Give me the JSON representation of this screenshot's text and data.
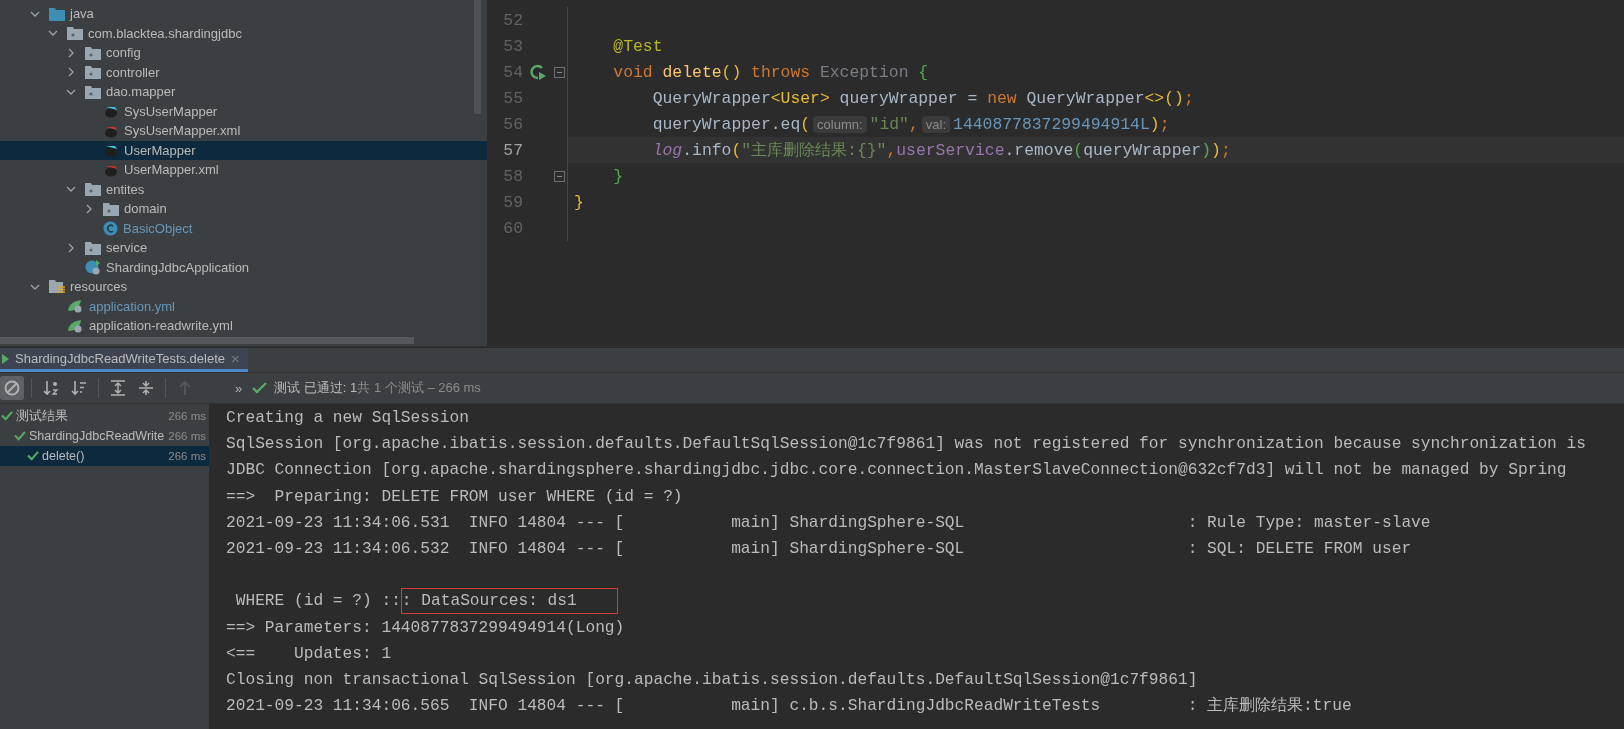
{
  "project_tree": {
    "items": [
      {
        "label": "java",
        "kind": "source-folder",
        "expanded": true,
        "selected": false,
        "modified": false,
        "children": [
          {
            "label": "com.blacktea.shardingjdbc",
            "kind": "package",
            "expanded": true,
            "selected": false,
            "modified": false,
            "children": [
              {
                "label": "config",
                "kind": "package",
                "expanded": false,
                "selected": false,
                "modified": false
              },
              {
                "label": "controller",
                "kind": "package",
                "expanded": false,
                "selected": false,
                "modified": false
              },
              {
                "label": "dao.mapper",
                "kind": "package",
                "expanded": true,
                "selected": false,
                "modified": false,
                "children": [
                  {
                    "label": "SysUserMapper",
                    "kind": "mapper",
                    "selected": false,
                    "modified": false
                  },
                  {
                    "label": "SysUserMapper.xml",
                    "kind": "mapper-xml",
                    "selected": false,
                    "modified": false
                  },
                  {
                    "label": "UserMapper",
                    "kind": "mapper",
                    "selected": true,
                    "modified": false
                  },
                  {
                    "label": "UserMapper.xml",
                    "kind": "mapper-xml",
                    "selected": false,
                    "modified": false
                  }
                ]
              },
              {
                "label": "entites",
                "kind": "package",
                "expanded": true,
                "selected": false,
                "modified": false,
                "children": [
                  {
                    "label": "domain",
                    "kind": "package",
                    "expanded": false,
                    "selected": false,
                    "modified": false
                  },
                  {
                    "label": "BasicObject",
                    "kind": "class",
                    "selected": false,
                    "modified": true
                  }
                ]
              },
              {
                "label": "service",
                "kind": "package",
                "expanded": false,
                "selected": false,
                "modified": false
              },
              {
                "label": "ShardingJdbcApplication",
                "kind": "spring-class",
                "selected": false,
                "modified": false
              }
            ]
          }
        ]
      },
      {
        "label": "resources",
        "kind": "resource-folder",
        "expanded": true,
        "selected": false,
        "modified": false,
        "children": [
          {
            "label": "application.yml",
            "kind": "yml",
            "selected": false,
            "modified": true
          },
          {
            "label": "application-readwrite.yml",
            "kind": "yml",
            "selected": false,
            "modified": false
          }
        ]
      }
    ]
  },
  "editor": {
    "lines": [
      {
        "number": "52",
        "current": false,
        "run_marker": false,
        "fold": false
      },
      {
        "number": "53",
        "kind": "member",
        "current": false,
        "run_marker": false,
        "fold": false,
        "tokens": [
          {
            "kind": "annotation",
            "text": "@Test"
          }
        ]
      },
      {
        "number": "54",
        "kind": "member",
        "current": false,
        "run_marker": true,
        "fold": true,
        "tokens": [
          {
            "kind": "keyword",
            "text": "void"
          },
          {
            "kind": "method",
            "text": "delete",
            "gap": true
          },
          {
            "kind": "paren1",
            "text": "()"
          },
          {
            "kind": "keyword",
            "text": "throws",
            "gap": true
          },
          {
            "kind": "unused",
            "text": "Exception",
            "gap": true
          },
          {
            "kind": "paren2",
            "text": "{",
            "gap": true
          }
        ]
      },
      {
        "number": "55",
        "kind": "statement",
        "current": false,
        "run_marker": false,
        "fold": false,
        "tokens": [
          {
            "kind": "plain",
            "text": "QueryWrapper"
          },
          {
            "kind": "paren1",
            "text": "<User>"
          },
          {
            "kind": "plain",
            "text": "queryWrapper =",
            "gap": true
          },
          {
            "kind": "keyword",
            "text": "new",
            "gap": true
          },
          {
            "kind": "plain",
            "text": "QueryWrapper",
            "gap": true
          },
          {
            "kind": "paren1",
            "text": "<>()"
          },
          {
            "kind": "keyword",
            "text": ";"
          }
        ]
      },
      {
        "number": "56",
        "kind": "statement",
        "current": false,
        "run_marker": false,
        "fold": false,
        "tokens": [
          {
            "kind": "plain",
            "text": "queryWrapper.eq"
          },
          {
            "kind": "paren1",
            "text": "("
          },
          {
            "kind": "hint",
            "text": "column:"
          },
          {
            "kind": "string",
            "text": "\"id\""
          },
          {
            "kind": "keyword",
            "text": ","
          },
          {
            "kind": "hint",
            "text": "val:"
          },
          {
            "kind": "number",
            "text": "1440877837299494914L"
          },
          {
            "kind": "paren1",
            "text": ")"
          },
          {
            "kind": "keyword",
            "text": ";"
          }
        ]
      },
      {
        "number": "57",
        "kind": "statement",
        "current": true,
        "run_marker": false,
        "fold": false,
        "tokens": [
          {
            "kind": "field",
            "text": "log"
          },
          {
            "kind": "plain",
            "text": ".info"
          },
          {
            "kind": "paren1",
            "text": "("
          },
          {
            "kind": "string",
            "text": "\"主库删除结果:{}\""
          },
          {
            "kind": "keyword",
            "text": ","
          },
          {
            "kind": "member",
            "text": "userService"
          },
          {
            "kind": "plain",
            "text": ".remove"
          },
          {
            "kind": "paren2",
            "text": "("
          },
          {
            "kind": "plain",
            "text": "queryWrapper"
          },
          {
            "kind": "paren2",
            "text": ")"
          },
          {
            "kind": "paren1",
            "text": ")"
          },
          {
            "kind": "keyword",
            "text": ";"
          }
        ]
      },
      {
        "number": "58",
        "kind": "member",
        "current": false,
        "run_marker": false,
        "fold": true,
        "tokens": [
          {
            "kind": "paren2",
            "text": "}"
          }
        ]
      },
      {
        "number": "59",
        "kind": "class",
        "current": false,
        "run_marker": false,
        "fold": false,
        "tokens": [
          {
            "kind": "paren1",
            "text": "}"
          }
        ]
      },
      {
        "number": "60",
        "current": false,
        "run_marker": false,
        "fold": false
      }
    ]
  },
  "run_tab": {
    "label": "ShardingJdbcReadWriteTests.delete",
    "close": "×",
    "selected": true
  },
  "toolbar": {
    "buttons": [
      {
        "kind": "ban",
        "pressed": true,
        "disabled": false
      },
      {
        "kind": "sort-alpha",
        "pressed": false,
        "disabled": false
      },
      {
        "kind": "sort-duration",
        "pressed": false,
        "disabled": false
      },
      {
        "kind": "expand",
        "pressed": false,
        "disabled": false
      },
      {
        "kind": "collapse",
        "pressed": false,
        "disabled": false
      },
      {
        "kind": "up",
        "pressed": false,
        "disabled": true
      }
    ],
    "more": "»",
    "status": "测试 已通过: 1",
    "summary": "共 1 个测试 – 266 ms"
  },
  "test_tree": {
    "items": [
      {
        "label": "测试结果",
        "duration": "266 ms",
        "passed": true,
        "selected": false,
        "children": [
          {
            "label": "ShardingJdbcReadWrite",
            "duration": "266 ms",
            "passed": true,
            "selected": false,
            "children": [
              {
                "label": "delete()",
                "duration": "266 ms",
                "passed": true,
                "selected": true
              }
            ]
          }
        ]
      }
    ]
  },
  "console": {
    "lines": [
      {
        "kind": "text",
        "text": "Creating a new SqlSession"
      },
      {
        "kind": "text",
        "text": "SqlSession [org.apache.ibatis.session.defaults.DefaultSqlSession@1c7f9861] was not registered for synchronization because synchronization is"
      },
      {
        "kind": "text",
        "text": "JDBC Connection [org.apache.shardingsphere.shardingjdbc.jdbc.core.connection.MasterSlaveConnection@632cf7d3] will not be managed by Spring"
      },
      {
        "kind": "text",
        "text": "==>  Preparing: DELETE FROM user WHERE (id = ?)"
      },
      {
        "kind": "text",
        "text": "2021-09-23 11:34:06.531  INFO 14804 --- [           main] ShardingSphere-SQL                       : Rule Type: master-slave"
      },
      {
        "kind": "text",
        "text": "2021-09-23 11:34:06.532  INFO 14804 --- [           main] ShardingSphere-SQL                       : SQL: DELETE FROM user"
      },
      {
        "kind": "blank"
      },
      {
        "kind": "segments",
        "segments": [
          {
            "text": " WHERE (id = ?) ::",
            "highlight": false
          },
          {
            "text": ": DataSources: ds1",
            "highlight": true
          }
        ]
      },
      {
        "kind": "text",
        "text": "==> Parameters: 1440877837299494914(Long)"
      },
      {
        "kind": "text",
        "text": "<==    Updates: 1"
      },
      {
        "kind": "text",
        "text": "Closing non transactional SqlSession [org.apache.ibatis.session.defaults.DefaultSqlSession@1c7f9861]"
      },
      {
        "kind": "text",
        "text": "2021-09-23 11:34:06.565  INFO 14804 --- [           main] c.b.s.ShardingJdbcReadWriteTests         : 主库删除结果:true"
      }
    ]
  }
}
